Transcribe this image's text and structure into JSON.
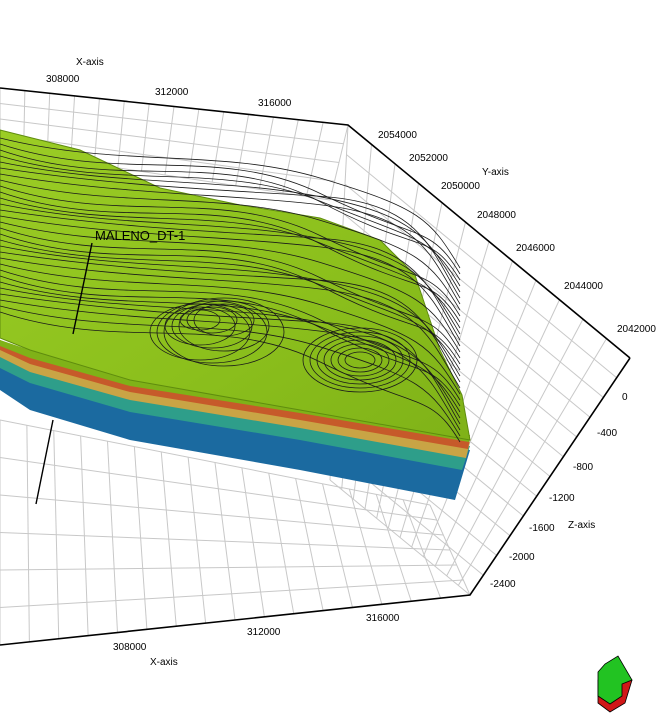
{
  "viewer": {
    "x_axis_title": "X-axis",
    "y_axis_title": "Y-axis",
    "z_axis_title": "Z-axis",
    "x_ticks_top": [
      "308000",
      "312000",
      "316000"
    ],
    "x_ticks_bottom": [
      "308000",
      "312000",
      "316000"
    ],
    "y_ticks": [
      "2054000",
      "2052000",
      "2050000",
      "2048000",
      "2046000",
      "2044000",
      "2042000"
    ],
    "z_ticks": [
      "0",
      "-400",
      "-800",
      "-1200",
      "-1600",
      "-2000",
      "-2400"
    ],
    "well_name": "MALENO_DT-1",
    "colors": {
      "surface": "#8ec31e",
      "surface_dark": "#6e9d12",
      "grid": "#c8c8c8",
      "orientation_top": "#22c322",
      "orientation_bottom": "#d01818"
    },
    "orientation_icon": "orientation-arrow-icon"
  }
}
